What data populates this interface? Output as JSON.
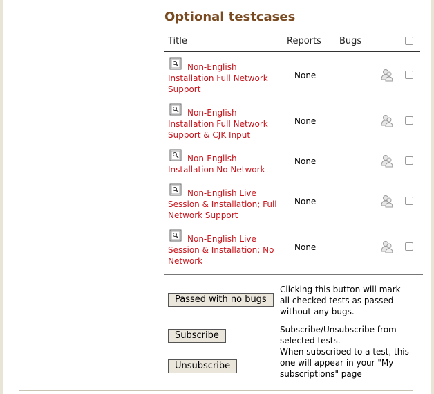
{
  "section": {
    "title": "Optional testcases"
  },
  "table": {
    "headers": {
      "title": "Title",
      "reports": "Reports",
      "bugs": "Bugs"
    },
    "rows": [
      {
        "title": "Non-English Installation Full Network Support",
        "reports": "None"
      },
      {
        "title": "Non-English Installation Full Network Support & CJK Input",
        "reports": "None"
      },
      {
        "title": "Non-English Installation No Network",
        "reports": "None"
      },
      {
        "title": "Non-English Live Session & Installation; Full Network Support",
        "reports": "None"
      },
      {
        "title": "Non-English Live Session & Installation; No Network",
        "reports": "None"
      }
    ]
  },
  "actions": {
    "passed_label": "Passed with no bugs",
    "passed_desc": "Clicking this button will mark all checked tests as passed without any bugs.",
    "subscribe_label": "Subscribe",
    "unsubscribe_label": "Unsubscribe",
    "subscribe_desc_1": "Subscribe/Unsubscribe from selected tests.",
    "subscribe_desc_2": "When subscribed to a test, this one will appear in your \"My subscriptions\" page"
  },
  "icons": {
    "testcase": "document-icon",
    "subscription": "subscribers-icon"
  },
  "colors": {
    "title": "#7a4a21",
    "link": "#c7161d",
    "button_bg": "#ebe6dc"
  }
}
